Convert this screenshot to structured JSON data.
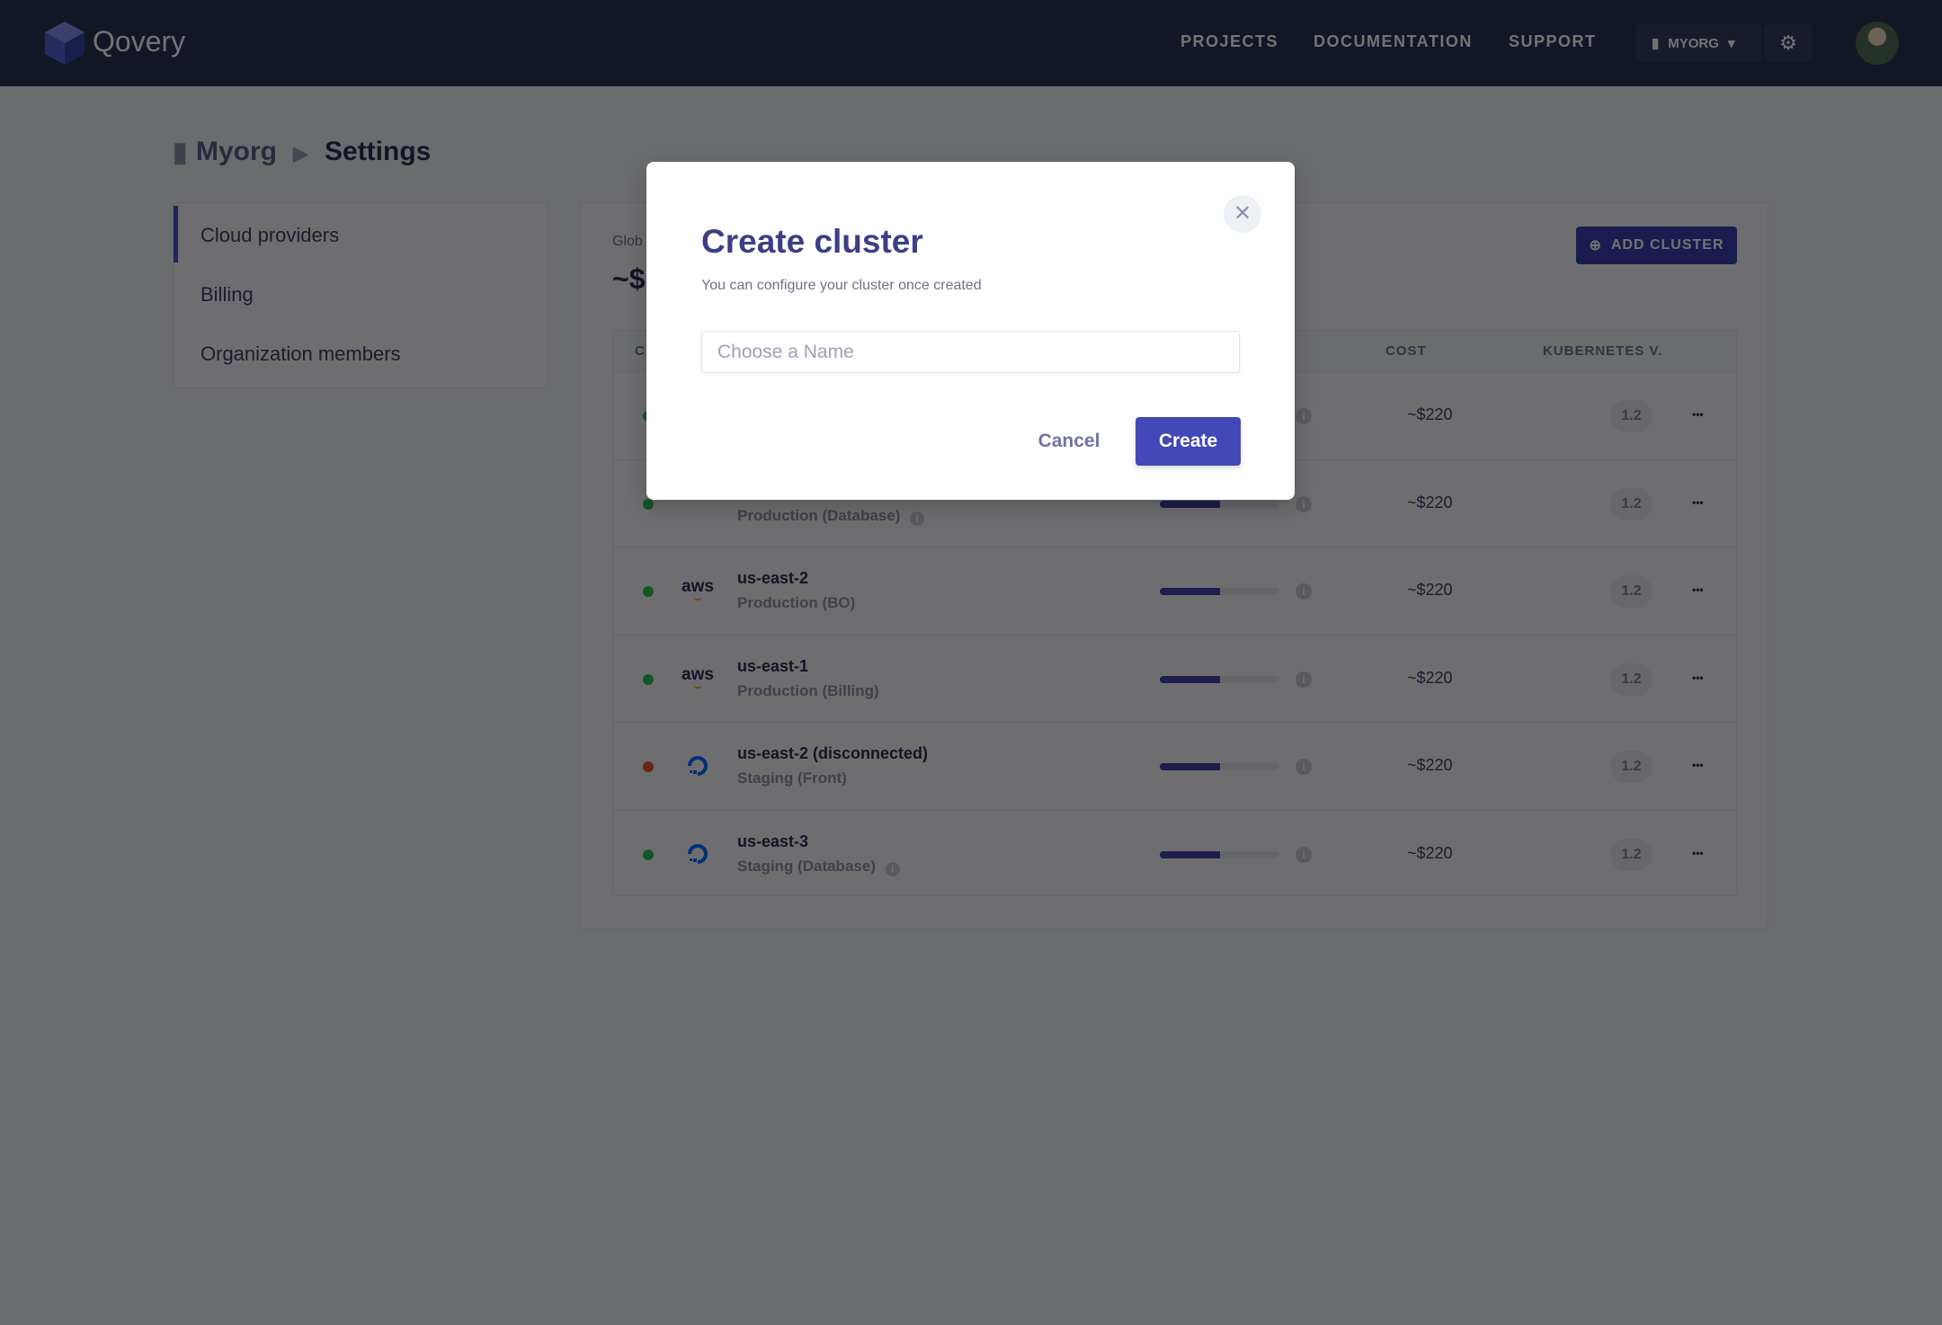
{
  "header": {
    "brand": "Qovery",
    "nav": [
      "PROJECTS",
      "DOCUMENTATION",
      "SUPPORT"
    ],
    "org": "MYORG"
  },
  "breadcrumb": {
    "org": "Myorg",
    "page": "Settings"
  },
  "sidebar": {
    "items": [
      {
        "label": "Cloud providers",
        "active": true
      },
      {
        "label": "Billing"
      },
      {
        "label": "Organization members"
      }
    ]
  },
  "main": {
    "global_label": "Glob",
    "global_value": "~$",
    "add_button": "ADD CLUSTER",
    "columns": {
      "first": "C",
      "cost": "COST",
      "kubernetes": "KUBERNETES V."
    },
    "rows": [
      {
        "name": "",
        "sub": "",
        "provider": "",
        "status": "green",
        "usage": 50,
        "cost": "~$220",
        "version": "1.2",
        "sub_info": false
      },
      {
        "name": "",
        "sub": "Production (Database)",
        "provider": "",
        "status": "green",
        "usage": 50,
        "cost": "~$220",
        "version": "1.2",
        "sub_info": true
      },
      {
        "name": "us-east-2",
        "sub": "Production (BO)",
        "provider": "aws",
        "status": "green",
        "usage": 50,
        "cost": "~$220",
        "version": "1.2",
        "sub_info": false
      },
      {
        "name": "us-east-1",
        "sub": "Production (Billing)",
        "provider": "aws",
        "status": "green",
        "usage": 50,
        "cost": "~$220",
        "version": "1.2",
        "sub_info": false
      },
      {
        "name": "us-east-2 (disconnected)",
        "sub": "Staging (Front)",
        "provider": "digitalocean",
        "status": "red",
        "usage": 50,
        "cost": "~$220",
        "version": "1.2",
        "sub_info": false
      },
      {
        "name": "us-east-3",
        "sub": "Staging (Database)",
        "provider": "digitalocean",
        "status": "green",
        "usage": 50,
        "cost": "~$220",
        "version": "1.2",
        "sub_info": true
      }
    ]
  },
  "modal": {
    "title": "Create cluster",
    "subtitle": "You can configure your cluster once created",
    "input_placeholder": "Choose a Name",
    "input_value": "",
    "cancel": "Cancel",
    "create": "Create"
  },
  "colors": {
    "accent": "#4248b8",
    "status_green": "#2fbf5a",
    "status_red": "#e5533c",
    "aws_orange": "#f90",
    "do_blue": "#0069ff"
  }
}
